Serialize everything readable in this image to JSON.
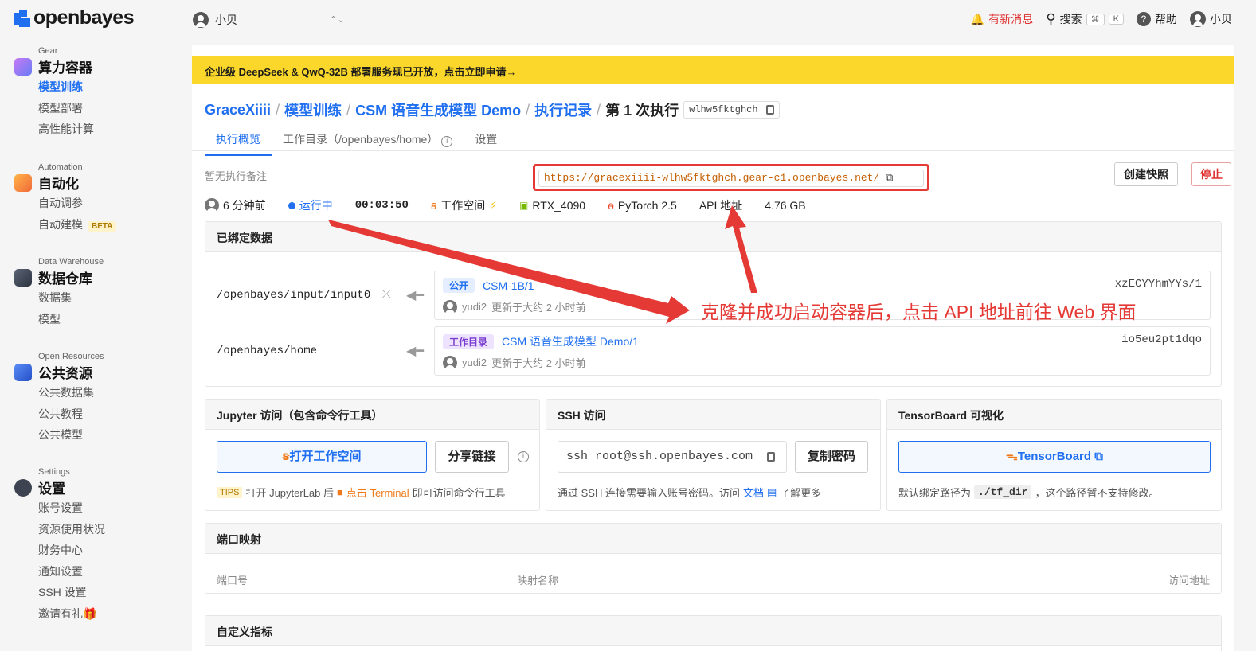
{
  "app": {
    "logo_text": "openbayes",
    "user_switch": "小贝",
    "top": {
      "notifications": "有新消息",
      "search": "搜索",
      "search_kbd1": "⌘",
      "search_kbd2": "K",
      "help": "帮助",
      "user": "小贝"
    }
  },
  "sidebar": {
    "gear": {
      "caption": "Gear",
      "title": "算力容器",
      "items": [
        "模型训练",
        "模型部署",
        "高性能计算"
      ]
    },
    "automation": {
      "caption": "Automation",
      "title": "自动化",
      "items": [
        "自动调参",
        "自动建模"
      ],
      "beta": "BETA"
    },
    "warehouse": {
      "caption": "Data Warehouse",
      "title": "数据仓库",
      "items": [
        "数据集",
        "模型"
      ]
    },
    "open": {
      "caption": "Open Resources",
      "title": "公共资源",
      "items": [
        "公共数据集",
        "公共教程",
        "公共模型"
      ]
    },
    "settings": {
      "caption": "Settings",
      "title": "设置",
      "items": [
        "账号设置",
        "资源使用状况",
        "财务中心",
        "通知设置",
        "SSH 设置",
        "邀请有礼"
      ]
    }
  },
  "banner": "企业级 DeepSeek & QwQ-32B 部署服务现已开放，点击立即申请→",
  "breadcrumb": {
    "items": [
      "GraceXiiii",
      "模型训练",
      "CSM 语音生成模型 Demo",
      "执行记录"
    ],
    "current": "第 1 次执行",
    "run_id": "wlhw5fktghch"
  },
  "tabs": [
    "执行概览",
    "工作目录（/openbayes/home）",
    "设置"
  ],
  "note": "暂无执行备注",
  "api_url": "https://gracexiiii-wlhw5fktghch.gear-c1.openbayes.net/",
  "buttons": {
    "snapshot": "创建快照",
    "stop": "停止"
  },
  "status": {
    "time_ago": "6 分钟前",
    "state": "运行中",
    "elapsed": "00:03:50",
    "workspace": "工作空间",
    "gpu": "RTX_4090",
    "framework": "PyTorch 2.5",
    "api": "API 地址",
    "size": "4.76 GB"
  },
  "bound_data": {
    "title": "已绑定数据",
    "rows": [
      {
        "mount": "/openbayes/input/input0",
        "tag": "公开",
        "name": "CSM-1B/1",
        "user": "yudi2",
        "updated": "更新于大约 2 小时前",
        "hash": "xzECYYhmYYs/1"
      },
      {
        "mount": "/openbayes/home",
        "tag": "工作目录",
        "name": "CSM 语音生成模型 Demo/1",
        "user": "yudi2",
        "updated": "更新于大约 2 小时前",
        "hash": "io5eu2pt1dqo"
      }
    ]
  },
  "jupyter": {
    "title": "Jupyter 访问（包含命令行工具）",
    "open_btn": "打开工作空间",
    "share_btn": "分享链接",
    "tips_tag": "TIPS",
    "tip_pre": "打开 JupyterLab 后",
    "tip_link": "点击 Terminal",
    "tip_post": "即可访问命令行工具"
  },
  "ssh": {
    "title": "SSH 访问",
    "command": "ssh root@ssh.openbayes.com",
    "copy_btn": "复制密码",
    "help_pre": "通过 SSH 连接需要输入账号密码。访问",
    "help_link": "文档",
    "help_post": "了解更多"
  },
  "tensorboard": {
    "title": "TensorBoard 可视化",
    "btn": "TensorBoard",
    "help_pre": "默认绑定路径为",
    "path": "./tf_dir",
    "help_post": "，这个路径暂不支持修改。"
  },
  "ports": {
    "title": "端口映射",
    "columns": [
      "端口号",
      "映射名称",
      "访问地址"
    ]
  },
  "metrics": {
    "title": "自定义指标"
  },
  "annotation": "克隆并成功启动容器后，点击 API 地址前往 Web 界面",
  "colors": {
    "accent": "#1f6ff0",
    "banner": "#fad72a",
    "annotation_red": "#e53935"
  }
}
